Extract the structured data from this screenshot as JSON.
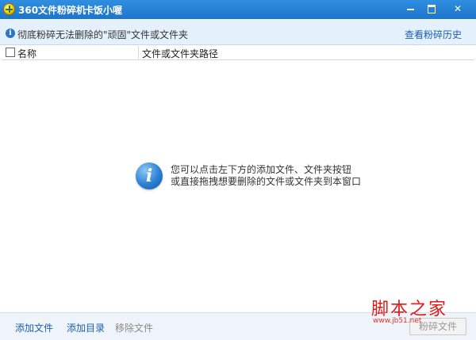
{
  "window": {
    "title": "360文件粉碎机",
    "subtitle": "卡饭小喔",
    "minimize_label": "",
    "maximize_label": "",
    "close_label": "✕"
  },
  "infobar": {
    "notice": "彻底粉碎无法删除的\"顽固\"文件或文件夹",
    "history_link": "查看粉碎历史",
    "info_glyph": "i"
  },
  "table": {
    "col_name": "名称",
    "col_path": "文件或文件夹路径"
  },
  "empty_state": {
    "icon_glyph": "i",
    "line1": "您可以点击左下方的添加文件、文件夹按钮",
    "line2": "或直接拖拽想要删除的文件或文件夹到本窗口"
  },
  "bottom": {
    "add_file": "添加文件",
    "add_dir": "添加目录",
    "remove_file": "移除文件",
    "shred": "粉碎文件"
  },
  "watermark": {
    "text": "脚本之家",
    "url": "www.jb51.net"
  },
  "colors": {
    "titlebar": "#1e74c9",
    "infobar": "#e4f0fb",
    "link": "#1b5fb1",
    "watermark": "#e11a1a"
  }
}
